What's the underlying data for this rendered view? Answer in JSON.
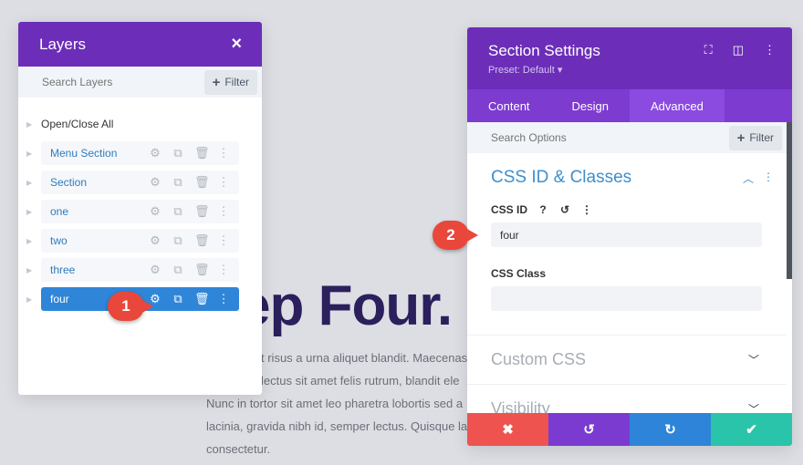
{
  "background": {
    "heading": "ep Four.",
    "paragraph_lines": [
      "t risus a urna aliquet blandit. Maecenas",
      "lectus sit amet felis rutrum, blandit ele",
      "Nunc in tortor sit amet leo pharetra lobortis sed a",
      "lacinia, gravida nibh id, semper lectus. Quisque la",
      "consectetur."
    ]
  },
  "layers": {
    "title": "Layers",
    "close_icon": "×",
    "search_placeholder": "Search Layers",
    "filter_label": "Filter",
    "open_close_all": "Open/Close All",
    "items": [
      {
        "label": "Menu Section"
      },
      {
        "label": "Section"
      },
      {
        "label": "one"
      },
      {
        "label": "two"
      },
      {
        "label": "three"
      },
      {
        "label": "four",
        "active": true
      }
    ]
  },
  "badges": {
    "one": "1",
    "two": "2"
  },
  "settings": {
    "title": "Section Settings",
    "preset": "Preset: Default ▾",
    "tabs": [
      "Content",
      "Design",
      "Advanced"
    ],
    "active_tab": "Advanced",
    "search_placeholder": "Search Options",
    "filter_label": "Filter",
    "group_title": "CSS ID & Classes",
    "css_id_label": "CSS ID",
    "css_id_value": "four",
    "css_class_label": "CSS Class",
    "css_class_value": "",
    "collapsed_groups": [
      "Custom CSS",
      "Visibility"
    ]
  },
  "colors": {
    "cancel": "#ef5350",
    "undo": "#7b3bd1",
    "redo": "#2e84d8",
    "save": "#29c4a9"
  }
}
